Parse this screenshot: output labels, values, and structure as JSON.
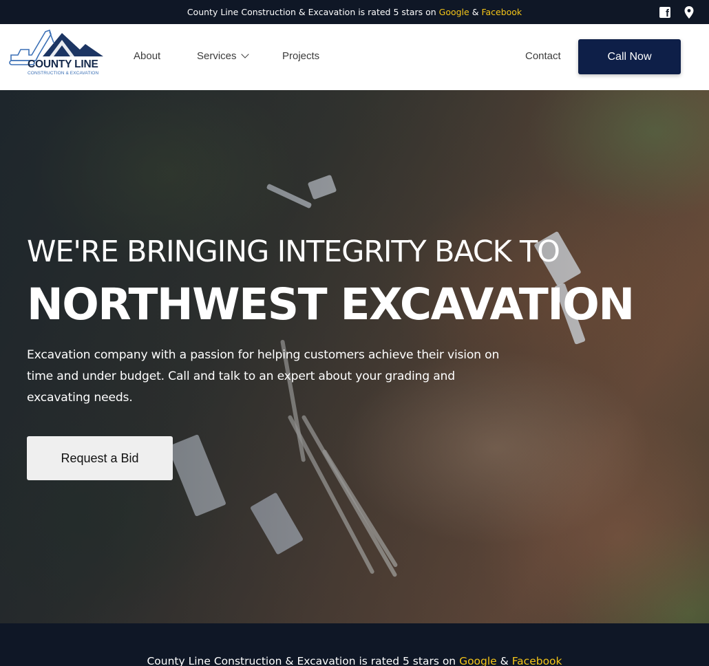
{
  "topbar": {
    "text_prefix": "County Line Construction & Excavation is rated 5 stars on ",
    "google": "Google",
    "amp": " & ",
    "facebook": "Facebook",
    "icons": [
      "facebook-icon",
      "location-pin-icon"
    ]
  },
  "header": {
    "logo": {
      "title": "COUNTY LINE",
      "subtitle": "CONSTRUCTION & EXCAVATION"
    },
    "nav": {
      "about": "About",
      "services": "Services",
      "projects": "Projects",
      "contact": "Contact"
    },
    "cta": "Call Now"
  },
  "hero": {
    "line1": "WE'RE BRINGING INTEGRITY BACK TO",
    "line2": "NORTHWEST EXCAVATION",
    "description": "Excavation company with a passion for helping customers achieve their vision on time and under budget. Call and talk to an expert about your grading and excavating needs.",
    "button": "Request a Bid"
  },
  "bottom": {
    "text_prefix": "County Line Construction & Excavation is rated 5 stars on ",
    "google": "Google",
    "amp": " & ",
    "facebook": "Facebook"
  },
  "colors": {
    "topbar_bg": "#0f1726",
    "highlight": "#f5c518",
    "cta_bg": "#0e1f48",
    "logo_navy": "#14284a"
  }
}
